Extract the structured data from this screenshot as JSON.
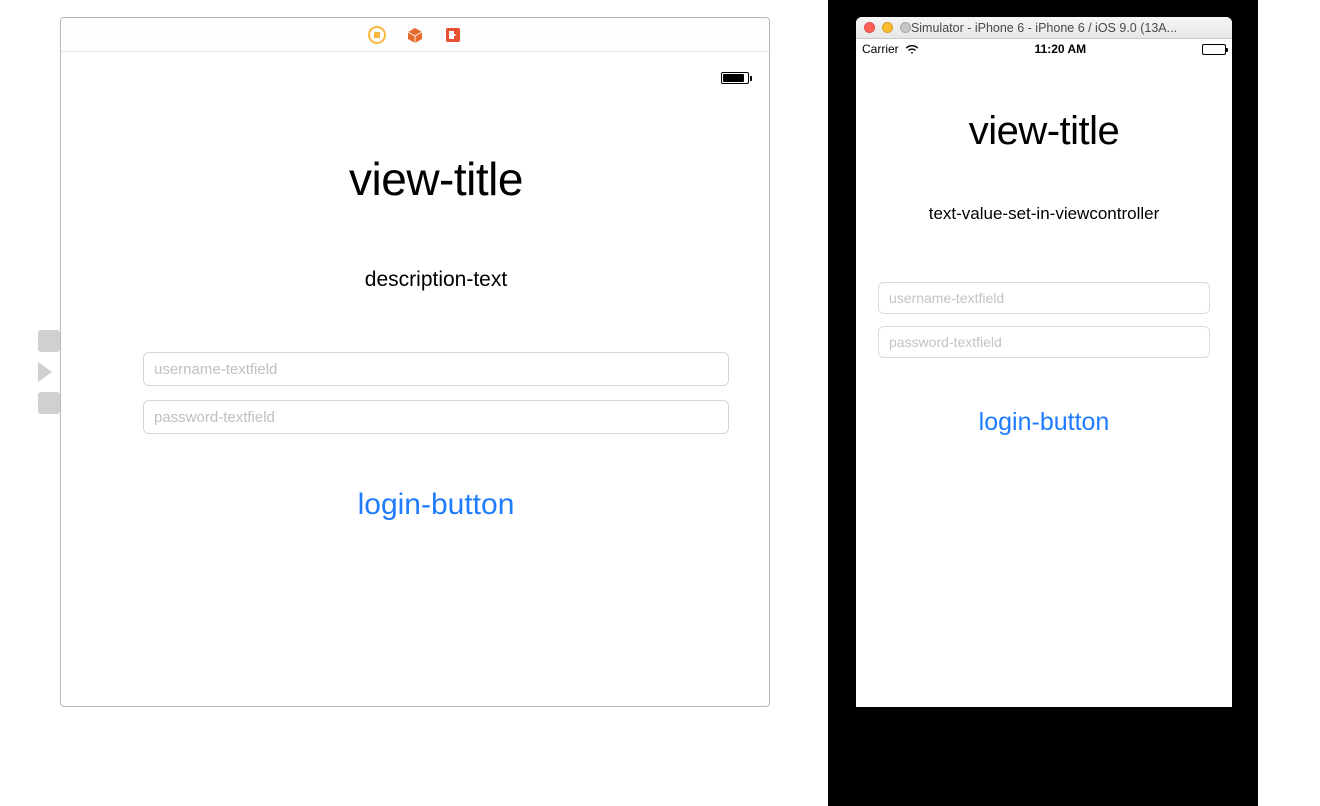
{
  "ib": {
    "title": "view-title",
    "description": "description-text",
    "username_placeholder": "username-textfield",
    "password_placeholder": "password-textfield",
    "login_label": "login-button"
  },
  "simulator": {
    "window_title": "Simulator - iPhone 6 - iPhone 6 / iOS 9.0 (13A...",
    "carrier": "Carrier",
    "time": "11:20 AM",
    "title": "view-title",
    "description": "text-value-set-in-viewcontroller",
    "username_placeholder": "username-textfield",
    "password_placeholder": "password-textfield",
    "login_label": "login-button"
  }
}
